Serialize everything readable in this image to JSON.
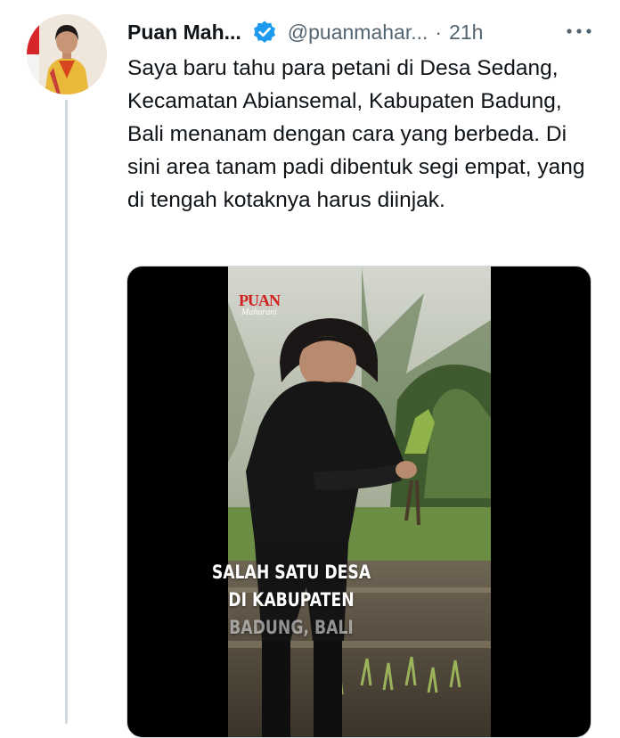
{
  "tweet": {
    "display_name": "Puan Mah...",
    "handle": "@puanmahar...",
    "separator": "·",
    "time": "21h",
    "more_icon": "more-horizontal-icon",
    "verified_icon": "verified-badge-icon",
    "text": "Saya baru tahu para petani di Desa Sedang, Kecamatan Abiansemal, Kabupaten Badung, Bali menanam dengan cara yang berbeda. Di sini area tanam padi dibentuk segi empat, yang di tengah kotaknya harus diinjak."
  },
  "media": {
    "logo_main": "PUAN",
    "logo_sub": "Maharani",
    "caption_lines": [
      "SALAH SATU DESA",
      "DI KABUPATEN",
      "BADUNG, BALI"
    ]
  },
  "colors": {
    "verified": "#1d9bf0",
    "secondary_text": "#536471",
    "thread_line": "#cfd9de",
    "logo_red": "#d21f1f"
  }
}
